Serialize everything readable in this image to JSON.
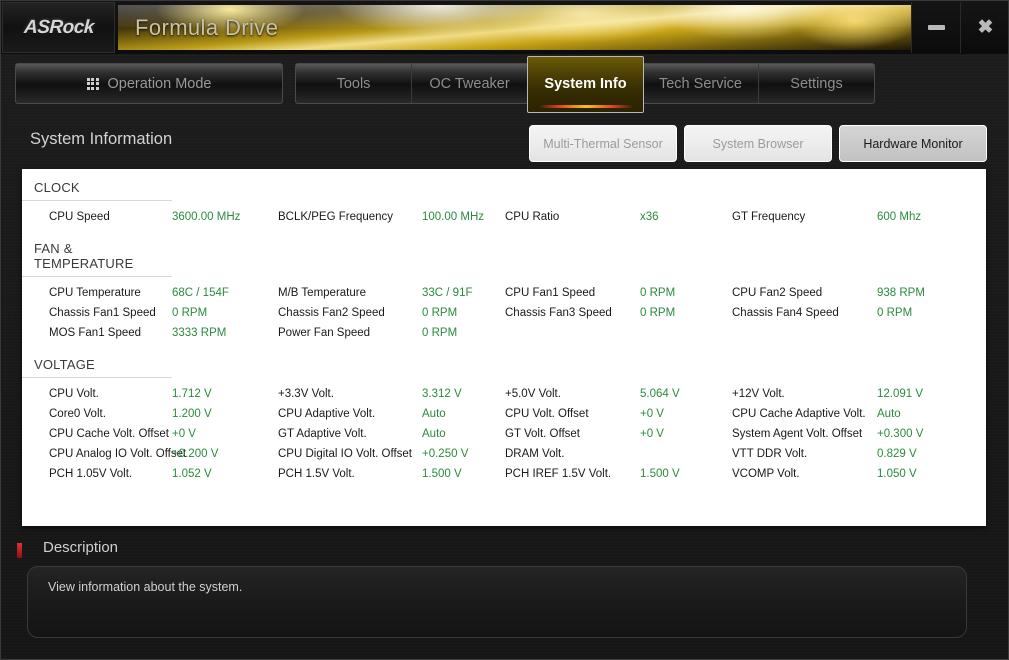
{
  "window": {
    "brand": "ASRock",
    "app_title": "Formula Drive",
    "minimize_label": "minimize",
    "close_label": "✖"
  },
  "toolbar": {
    "operation_mode_label": "Operation Mode",
    "operation_mode_icon": "grid-icon",
    "tabs": [
      {
        "label": "Tools",
        "active": false
      },
      {
        "label": "OC Tweaker",
        "active": false
      },
      {
        "label": "System Info",
        "active": true
      },
      {
        "label": "Tech Service",
        "active": false
      },
      {
        "label": "Settings",
        "active": false
      }
    ]
  },
  "page": {
    "title": "System Information",
    "subtabs": [
      {
        "label": "Multi-Thermal Sensor",
        "active": false
      },
      {
        "label": "System Browser",
        "active": false
      },
      {
        "label": "Hardware Monitor",
        "active": true
      }
    ]
  },
  "groups": [
    {
      "title": "CLOCK",
      "rows": [
        [
          {
            "label": "CPU Speed",
            "value": "3600.00 MHz"
          },
          {
            "label": "BCLK/PEG Frequency",
            "value": "100.00 MHz"
          },
          {
            "label": "CPU Ratio",
            "value": "x36"
          },
          {
            "label": "GT Frequency",
            "value": "600 Mhz"
          }
        ]
      ]
    },
    {
      "title": "FAN & TEMPERATURE",
      "rows": [
        [
          {
            "label": "CPU Temperature",
            "value": "68C / 154F"
          },
          {
            "label": "M/B Temperature",
            "value": "33C / 91F"
          },
          {
            "label": "CPU Fan1 Speed",
            "value": "0 RPM"
          },
          {
            "label": "CPU Fan2 Speed",
            "value": "938 RPM"
          }
        ],
        [
          {
            "label": "Chassis Fan1 Speed",
            "value": "0 RPM"
          },
          {
            "label": "Chassis Fan2 Speed",
            "value": "0 RPM"
          },
          {
            "label": "Chassis Fan3 Speed",
            "value": "0 RPM"
          },
          {
            "label": "Chassis Fan4 Speed",
            "value": "0 RPM"
          }
        ],
        [
          {
            "label": "MOS Fan1 Speed",
            "value": "3333 RPM"
          },
          {
            "label": "Power Fan Speed",
            "value": "0 RPM"
          },
          {
            "label": "",
            "value": ""
          },
          {
            "label": "",
            "value": ""
          }
        ]
      ]
    },
    {
      "title": "VOLTAGE",
      "rows": [
        [
          {
            "label": "CPU Volt.",
            "value": "1.712 V"
          },
          {
            "label": "+3.3V Volt.",
            "value": "3.312 V"
          },
          {
            "label": "+5.0V Volt.",
            "value": "5.064 V"
          },
          {
            "label": "+12V Volt.",
            "value": "12.091 V"
          }
        ],
        [
          {
            "label": "Core0 Volt.",
            "value": "1.200 V"
          },
          {
            "label": "CPU Adaptive Volt.",
            "value": "Auto"
          },
          {
            "label": "CPU Volt. Offset",
            "value": "+0 V"
          },
          {
            "label": "CPU Cache Adaptive Volt.",
            "value": "Auto"
          }
        ],
        [
          {
            "label": "CPU Cache Volt. Offset",
            "value": "+0 V"
          },
          {
            "label": "GT Adaptive Volt.",
            "value": "Auto"
          },
          {
            "label": "GT Volt. Offset",
            "value": "+0 V"
          },
          {
            "label": "System Agent Volt. Offset",
            "value": "+0.300 V"
          }
        ],
        [
          {
            "label": "CPU Analog IO Volt. Offset",
            "value": "+0.200 V"
          },
          {
            "label": "CPU Digital IO Volt. Offset",
            "value": "+0.250 V"
          },
          {
            "label": "DRAM Volt.",
            "value": ""
          },
          {
            "label": "VTT DDR Volt.",
            "value": "0.829 V"
          }
        ],
        [
          {
            "label": "PCH 1.05V Volt.",
            "value": "1.052 V"
          },
          {
            "label": "PCH 1.5V Volt.",
            "value": "1.500 V"
          },
          {
            "label": "PCH IREF 1.5V Volt.",
            "value": "1.500 V"
          },
          {
            "label": "VCOMP Volt.",
            "value": "1.050 V"
          }
        ]
      ]
    }
  ],
  "description": {
    "title": "Description",
    "text": "View information about the system."
  },
  "colors": {
    "value_green": "#2b8a3e",
    "accent_gold": "#f5c02a",
    "accent_red": "#d8421f"
  }
}
